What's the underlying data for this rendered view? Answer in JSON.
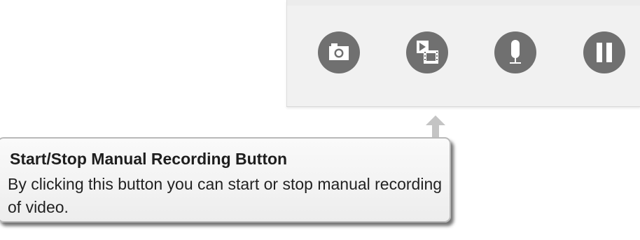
{
  "toolbar": {
    "buttons": [
      {
        "id": "snapshot",
        "icon": "camera-icon"
      },
      {
        "id": "manual-record",
        "icon": "film-record-icon"
      },
      {
        "id": "audio",
        "icon": "microphone-icon"
      },
      {
        "id": "pause",
        "icon": "pause-icon"
      }
    ],
    "button_color": "#707070",
    "icon_color": "#ffffff"
  },
  "callout": {
    "title": "Start/Stop Manual Recording Button",
    "body": "By clicking this button you can start or stop manual recording of video."
  }
}
